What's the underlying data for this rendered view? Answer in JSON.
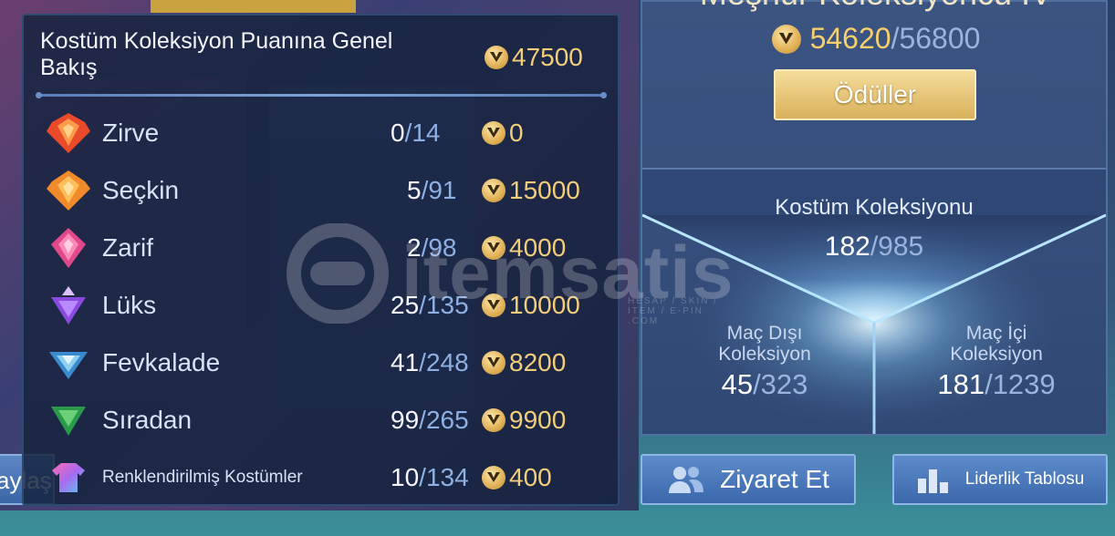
{
  "overview": {
    "title": "Kostüm Koleksiyon Puanına Genel Bakış",
    "total_points": "47500",
    "rows": [
      {
        "name": "Zirve",
        "owned": "0",
        "total": "14",
        "points": "0",
        "gem": "gem-red"
      },
      {
        "name": "Seçkin",
        "owned": "5",
        "total": "91",
        "points": "15000",
        "gem": "gem-orange"
      },
      {
        "name": "Zarif",
        "owned": "2",
        "total": "98",
        "points": "4000",
        "gem": "gem-pink"
      },
      {
        "name": "Lüks",
        "owned": "25",
        "total": "135",
        "points": "10000",
        "gem": "gem-purple"
      },
      {
        "name": "Fevkalade",
        "owned": "41",
        "total": "248",
        "points": "8200",
        "gem": "gem-blue"
      },
      {
        "name": "Sıradan",
        "owned": "99",
        "total": "265",
        "points": "9900",
        "gem": "gem-green"
      },
      {
        "name": "Renklendirilmiş Kostümler",
        "owned": "10",
        "total": "134",
        "points": "400",
        "gem": "shirt"
      }
    ]
  },
  "card": {
    "title": "Meşhur Koleksiyoncu IV",
    "score": "54620",
    "score_max": "/56800",
    "rewards_label": "Ödüller",
    "costume_label": "Kostüm Koleksiyonu",
    "costume_owned": "182",
    "costume_total": "/985",
    "outside": {
      "label_line1": "Maç Dışı",
      "label_line2": "Koleksiyon",
      "owned": "45",
      "total": "/323"
    },
    "inside": {
      "label_line1": "Maç İçi",
      "label_line2": "Koleksiyon",
      "owned": "181",
      "total": "/1239"
    }
  },
  "buttons": {
    "share_label": "aylaş",
    "visit_label": "Ziyaret Et",
    "leaderboard_label": "Liderlik Tablosu"
  },
  "watermark": {
    "text": "itemsatis",
    "sub": "HESAP / SKIN / ITEM / E-PIN .COM"
  },
  "colors": {
    "points_gold": "#f2cd7a",
    "count_blue": "#8fb0e2",
    "button_blue": "#4a78ba",
    "reward_gold": "#e2bc6a"
  }
}
